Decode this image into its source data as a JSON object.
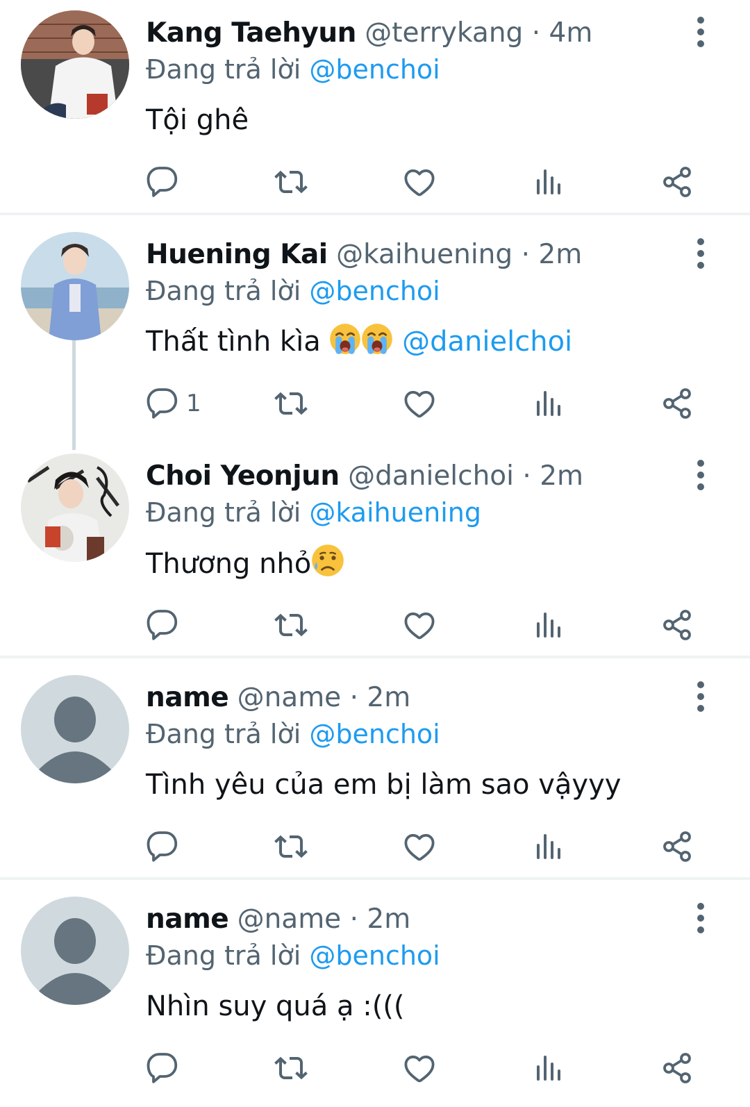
{
  "reply_prefix": "Đang trả lời",
  "colors": {
    "text": "#0f1419",
    "secondary": "#536471",
    "accent": "#1d9bf0",
    "divider": "#eff3f4",
    "thread_line": "#cfd9de"
  },
  "tweets": [
    {
      "name": "Kang Taehyun",
      "handle": "@terrykang",
      "separator": "·",
      "time": "4m",
      "replying_to": "@benchoi",
      "text": "Tội ghê",
      "mention": "",
      "reply_count": "",
      "avatar": "photo-avatar-kang-taehyun"
    },
    {
      "name": "Huening Kai",
      "handle": "@kaihuening",
      "separator": "·",
      "time": "2m",
      "replying_to": "@benchoi",
      "text": "Thất tình kìa",
      "emoji": [
        "loudly-crying-face-emoji",
        "loudly-crying-face-emoji"
      ],
      "mention": "@danielchoi",
      "reply_count": "1",
      "avatar": "photo-avatar-huening-kai"
    },
    {
      "name": "Choi Yeonjun",
      "handle": "@danielchoi",
      "separator": "·",
      "time": "2m",
      "replying_to": "@kaihuening",
      "text": "Thương nhỏ",
      "emoji": [
        "crying-face-emoji"
      ],
      "mention": "",
      "reply_count": "",
      "avatar": "photo-avatar-choi-yeonjun"
    },
    {
      "name": "name",
      "handle": "@name",
      "separator": "·",
      "time": "2m",
      "replying_to": "@benchoi",
      "text": "Tình yêu của em bị làm sao vậyyy",
      "mention": "",
      "reply_count": "",
      "avatar": "default-avatar"
    },
    {
      "name": "name",
      "handle": "@name",
      "separator": "·",
      "time": "2m",
      "replying_to": "@benchoi",
      "text": "Nhìn suy quá ạ :(((",
      "mention": "",
      "reply_count": "",
      "avatar": "default-avatar"
    }
  ],
  "action_icons": [
    "reply-icon",
    "retweet-icon",
    "like-icon",
    "views-icon",
    "share-icon"
  ]
}
